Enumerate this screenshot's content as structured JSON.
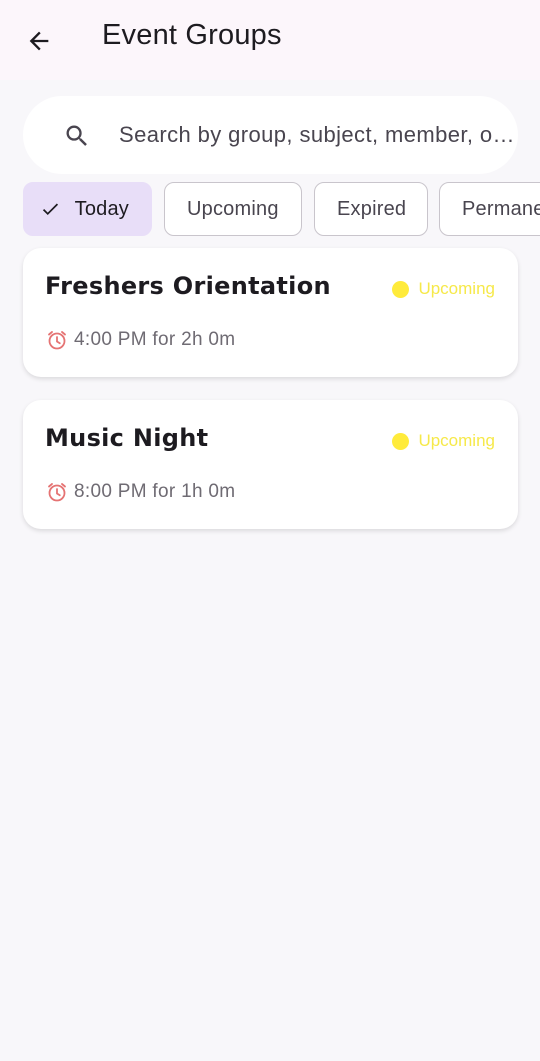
{
  "app_bar": {
    "title": "Event Groups"
  },
  "search": {
    "placeholder": "Search by group, subject, member, o…"
  },
  "filters": [
    {
      "label": "Today",
      "selected": true
    },
    {
      "label": "Upcoming",
      "selected": false
    },
    {
      "label": "Expired",
      "selected": false
    },
    {
      "label": "Permane",
      "selected": false
    }
  ],
  "groups": [
    {
      "name": "Freshers Orientation",
      "status": "Upcoming",
      "time": "4:00 PM for 2h 0m"
    },
    {
      "name": "Music Night",
      "status": "Upcoming",
      "time": "8:00 PM for 1h 0m"
    }
  ],
  "colors": {
    "app_bar_bg": "#fcf6fb",
    "selected_chip_bg": "#e8def8",
    "status_upcoming": "#ffeb3b",
    "page_bg": "#f8f7fa"
  },
  "icons": {
    "back": "arrow-left-icon",
    "search": "search-icon",
    "check": "check-icon",
    "clock": "alarm-clock-icon"
  }
}
